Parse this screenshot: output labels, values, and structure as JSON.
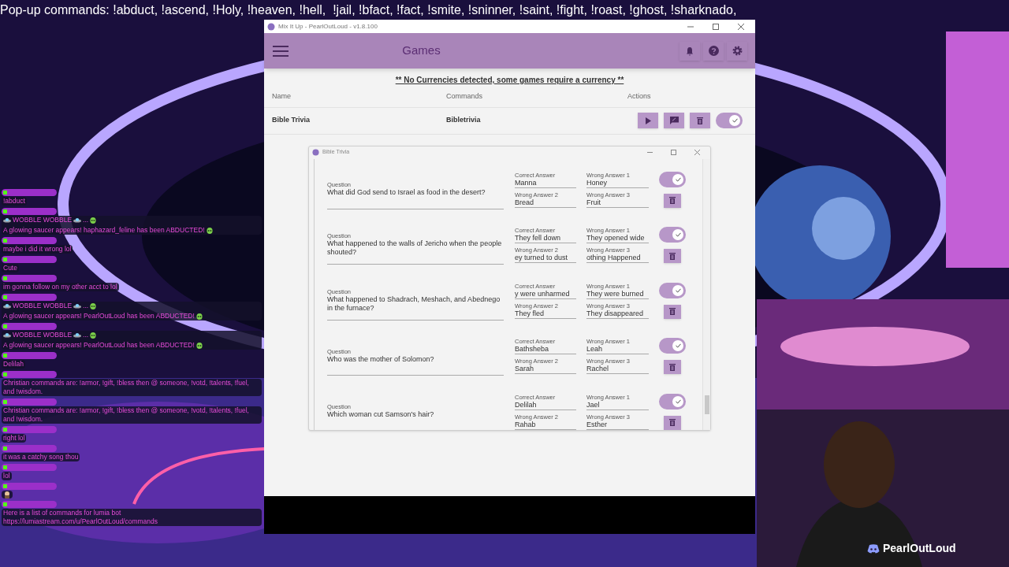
{
  "banner": "Pop-up commands: !abduct, !ascend, !Holy, !heaven, !hell,  !jail, !bfact, !fact, !smite, !sninner, !saint, !fight, !roast, !ghost, !sharknado,",
  "chat": [
    {
      "kind": "text",
      "text": "!abduct"
    },
    {
      "kind": "abduction",
      "lead": "WOBBLE WOBBLE",
      "dots": "...",
      "text": "A glowing saucer appears! haphazard_feline has been ABDUCTED!"
    },
    {
      "kind": "text",
      "text": "maybe i did it wrong lol"
    },
    {
      "kind": "text",
      "text": "Cute"
    },
    {
      "kind": "text",
      "text": "im gonna follow on my other acct to lol"
    },
    {
      "kind": "abduction",
      "lead": "WOBBLE WOBBLE",
      "dots": "...",
      "text": "A glowing saucer appears! PearlOutLoud has been ABDUCTED!"
    },
    {
      "kind": "abduction",
      "lead": "WOBBLE WOBBLE",
      "dots": "...",
      "text": "A glowing saucer appears! PearlOutLoud has been ABDUCTED!"
    },
    {
      "kind": "text",
      "text": "Delilah"
    },
    {
      "kind": "text",
      "text": "Christian commands are: !armor, !gift, !bless then @ someone, !votd, !talents, !fuel, and !wisdom."
    },
    {
      "kind": "text",
      "text": "Christian commands are: !armor, !gift, !bless then @ someone, !votd, !talents, !fuel, and !wisdom."
    },
    {
      "kind": "text",
      "text": "right lol"
    },
    {
      "kind": "text",
      "text": "it was a catchy song thou"
    },
    {
      "kind": "text",
      "text": "lol"
    },
    {
      "kind": "sticker"
    },
    {
      "kind": "text",
      "text": "Here is a list of commands for lumia bot https://lumiastream.com/u/PearlOutLoud/commands"
    }
  ],
  "app": {
    "title": "Mix It Up - PearlOutLoud - v1.8.100",
    "page_title": "Games",
    "notice": "** No Currencies detected, some games require a currency **",
    "columns": [
      "Name",
      "Commands",
      "Actions"
    ],
    "games": [
      {
        "name": "Bible Trivia",
        "command": "Bibletrivia",
        "enabled": true
      }
    ],
    "dialog": {
      "title": "Bible Trivia",
      "questions": [
        {
          "label": "Question",
          "text": "What did God send to Israel as food in the desert?",
          "enabled": true,
          "fields": [
            {
              "label": "Correct Answer",
              "value": "Manna"
            },
            {
              "label": "Wrong Answer 1",
              "value": "Honey"
            },
            {
              "label": "Wrong Answer 2",
              "value": "Bread"
            },
            {
              "label": "Wrong Answer 3",
              "value": "Fruit"
            }
          ]
        },
        {
          "label": "Question",
          "text": "What happened to the walls of Jericho when the people shouted?",
          "enabled": true,
          "fields": [
            {
              "label": "Correct Answer",
              "value": "They fell down"
            },
            {
              "label": "Wrong Answer 1",
              "value": "They opened wide"
            },
            {
              "label": "Wrong Answer 2",
              "value": "ey turned to dust"
            },
            {
              "label": "Wrong Answer 3",
              "value": "othing Happened"
            }
          ]
        },
        {
          "label": "Question",
          "text": "What happened to Shadrach, Meshach, and Abednego in the furnace?",
          "enabled": true,
          "fields": [
            {
              "label": "Correct Answer",
              "value": "y were unharmed"
            },
            {
              "label": "Wrong Answer 1",
              "value": "They were burned"
            },
            {
              "label": "Wrong Answer 2",
              "value": "They fled"
            },
            {
              "label": "Wrong Answer 3",
              "value": "They disappeared"
            }
          ]
        },
        {
          "label": "Question",
          "text": "Who was the mother of Solomon?",
          "enabled": true,
          "fields": [
            {
              "label": "Correct Answer",
              "value": "Bathsheba"
            },
            {
              "label": "Wrong Answer 1",
              "value": "Leah"
            },
            {
              "label": "Wrong Answer 2",
              "value": "Sarah"
            },
            {
              "label": "Wrong Answer 3",
              "value": "Rachel"
            }
          ]
        },
        {
          "label": "Question",
          "text": "Which woman cut Samson's hair?",
          "enabled": true,
          "fields": [
            {
              "label": "Correct Answer",
              "value": "Delilah"
            },
            {
              "label": "Wrong Answer 1",
              "value": "Jael"
            },
            {
              "label": "Wrong Answer 2",
              "value": "Rahab"
            },
            {
              "label": "Wrong Answer 3",
              "value": "Esther"
            }
          ]
        }
      ]
    }
  },
  "streamer_tag": "PearlOutLoud"
}
